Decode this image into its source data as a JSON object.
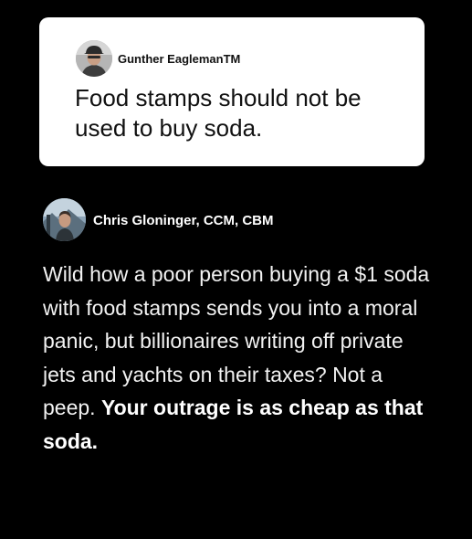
{
  "quoted_post": {
    "author": "Gunther EaglemanTM",
    "text": "Food stamps should not be used to buy soda.",
    "avatar_icon": "man-with-cap-avatar"
  },
  "reply_post": {
    "author": "Chris Gloninger, CCM, CBM",
    "text_regular": "Wild how a poor person buying a $1 soda with food stamps sends you into a moral panic, but billionaires writing off private jets and yachts on their taxes? Not a peep. ",
    "text_bold": "Your outrage is as cheap as that soda.",
    "avatar_icon": "man-outdoors-avatar"
  },
  "colors": {
    "background": "#000000",
    "card": "#ffffff",
    "reply_text": "#f2f2f2"
  }
}
